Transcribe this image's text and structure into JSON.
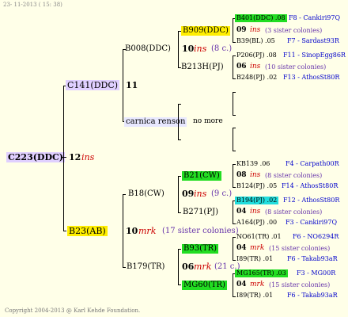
{
  "header": {
    "date": "23- 11-2013 ( 15: 38)"
  },
  "copyright": "Copyright 2004-2013 @ Karl Kehde Foundation.",
  "colors": {
    "background": "#ffffe8",
    "lilac": "#e0d0ff",
    "yellow": "#ffee00",
    "green": "#22dd22",
    "cyan": "#22dddd",
    "blue_text": "#0000cc",
    "red_text": "#cc0000"
  },
  "root": {
    "name": "C223(DDC)",
    "num": "12",
    "ins": "ins"
  },
  "gen1": {
    "upper": {
      "name": "C141(DDC)",
      "num": "11"
    },
    "lower": {
      "name": "B23(AB)",
      "num": "10",
      "ins": "mrk",
      "sisters": "(17 sister colonies)"
    }
  },
  "gen2": {
    "b008": {
      "name": "B008(DDC)",
      "num": "10",
      "ins": "ins",
      "sisters": "(8 c.)"
    },
    "carnica": {
      "name": "carnica renson",
      "nomore": "no more"
    },
    "b18": {
      "name": "B18(CW)",
      "num": "09",
      "ins": "ins",
      "sisters": "(9 c.)"
    },
    "b179": {
      "name": "B179(TR)",
      "num": "06",
      "ins": "mrk",
      "sisters": "(21 c.)"
    }
  },
  "gen3": {
    "b909": {
      "name": "B909(DDC)"
    },
    "b213": {
      "name": "B213H(PJ)"
    },
    "b21": {
      "name": "B21(CW)"
    },
    "b271": {
      "name": "B271(PJ)"
    },
    "b93": {
      "name": "B93(TR)"
    },
    "mg60": {
      "name": "MG60(TR)"
    }
  },
  "gen4": {
    "r1": {
      "left": "B401(DDC) .08",
      "right": "F8 - Cankiri97Q"
    },
    "r2": {
      "num": "09",
      "ins": "ins",
      "sis": "(3 sister colonies)"
    },
    "r3": {
      "left": "B39(BL) .05",
      "right": "F7 - Sardast93R"
    },
    "r4": {
      "left": "P206(PJ) .08",
      "right": "F11 - SinopEgg86R"
    },
    "r5": {
      "num": "06",
      "ins": "ins",
      "sis": "(10 sister colonies)"
    },
    "r6": {
      "left": "B248(PJ) .02",
      "right": "F13 - AthosSt80R"
    },
    "r7": {
      "left": "KB139 .06",
      "right": "F4 - Carpath00R"
    },
    "r8": {
      "num": "08",
      "ins": "ins",
      "sis": "(8 sister colonies)"
    },
    "r9": {
      "left": "B124(PJ) .05",
      "right": "F14 - AthosSt80R"
    },
    "r10": {
      "left": "B194(PJ) .02",
      "right": "F12 - AthosSt80R"
    },
    "r11": {
      "num": "04",
      "ins": "ins",
      "sis": "(8 sister colonies)"
    },
    "r12": {
      "left": "A164(PJ) .00",
      "right": "F3 - Cankiri97Q"
    },
    "r13": {
      "left": "NO61(TR) .01",
      "right": "F6 - NO6294R"
    },
    "r14": {
      "num": "04",
      "ins": "mrk",
      "sis": "(15 sister colonies)"
    },
    "r15": {
      "left": "I89(TR) .01",
      "right": "F6 - Takab93aR"
    },
    "r16": {
      "left": "MG165(TR) .03",
      "right": "F3 - MG00R"
    },
    "r17": {
      "num": "04",
      "ins": "mrk",
      "sis": "(15 sister colonies)"
    },
    "r18": {
      "left": "I89(TR) .01",
      "right": "F6 - Takab93aR"
    }
  }
}
